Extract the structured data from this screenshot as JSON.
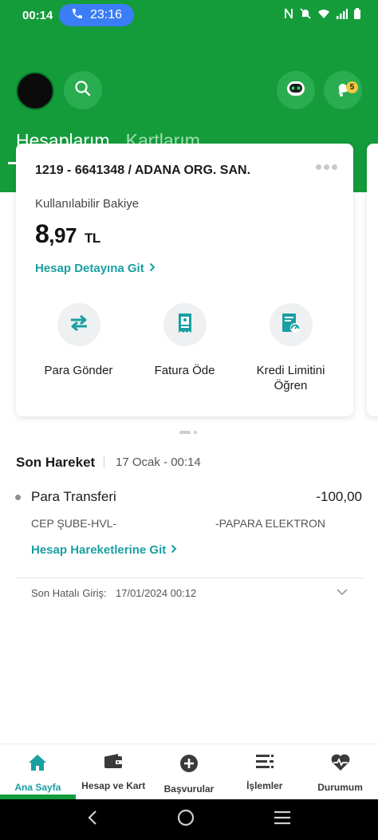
{
  "status_bar": {
    "time": "00:14",
    "call_time": "23:16"
  },
  "header": {
    "tabs": [
      {
        "label": "Hesaplarım",
        "active": true
      },
      {
        "label": "Kartlarım",
        "active": false
      }
    ],
    "notification_count": "5"
  },
  "account_card": {
    "title": "1219 - 6641348 / ADANA ORG. SAN.",
    "balance_label": "Kullanılabilir Bakiye",
    "balance_integer": "8",
    "balance_decimal": ",97",
    "currency": "TL",
    "detail_link": "Hesap Detayına Git",
    "actions": [
      {
        "label": "Para Gönder",
        "icon": "transfer-arrows-icon"
      },
      {
        "label": "Fatura Öde",
        "icon": "bill-icon"
      },
      {
        "label": "Kredi Limitini Öğren",
        "icon": "credit-limit-icon"
      }
    ]
  },
  "last_transaction": {
    "title": "Son Hareket",
    "date": "17 Ocak - 00:14",
    "name": "Para Transferi",
    "amount": "-100,00",
    "sub_left": "CEP ŞUBE-HVL-",
    "sub_right": "-PAPARA ELEKTRON",
    "link": "Hesap Hareketlerine Git",
    "last_failed_login_label": "Son Hatalı Giriş:",
    "last_failed_login_value": "17/01/2024 00:12"
  },
  "bottom_nav": [
    {
      "label": "Ana Sayfa",
      "icon": "home-icon",
      "active": true
    },
    {
      "label": "Hesap ve Kart",
      "icon": "wallet-icon",
      "active": false
    },
    {
      "label": "Başvurular",
      "icon": "plus-circle-icon",
      "active": false
    },
    {
      "label": "İşlemler",
      "icon": "list-icon",
      "active": false
    },
    {
      "label": "Durumum",
      "icon": "heart-pulse-icon",
      "active": false
    }
  ],
  "colors": {
    "brand_green": "#149c3b",
    "accent_teal": "#1a9fa2",
    "call_pill_blue": "#3b7df6",
    "badge_yellow": "#f4c842"
  }
}
